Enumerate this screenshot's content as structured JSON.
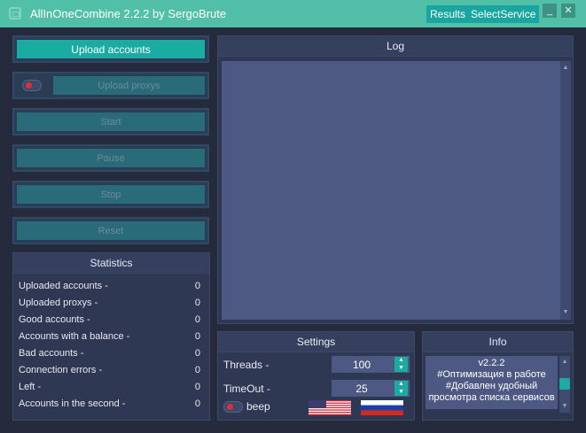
{
  "titlebar": {
    "title": "AllInOneCombine 2.2.2 by SergoBrute",
    "tabs": [
      "Results",
      "SelectService"
    ],
    "minimize_label": "_",
    "close_label": "✕"
  },
  "left_buttons": {
    "upload_accounts": "Upload accounts",
    "upload_proxys": "Upload proxys",
    "start": "Start",
    "pause": "Pause",
    "stop": "Stop",
    "reset": "Reset"
  },
  "statistics": {
    "title": "Statistics",
    "rows": [
      {
        "label": "Uploaded accounts -",
        "value": "0"
      },
      {
        "label": "Uploaded proxys -",
        "value": "0"
      },
      {
        "label": "Good accounts -",
        "value": "0"
      },
      {
        "label": "Accounts with a balance -",
        "value": "0"
      },
      {
        "label": "Bad accounts -",
        "value": "0"
      },
      {
        "label": "Connection errors -",
        "value": "0"
      },
      {
        "label": "Left -",
        "value": "0"
      },
      {
        "label": "Accounts in the second -",
        "value": "0"
      }
    ]
  },
  "log": {
    "title": "Log",
    "content": ""
  },
  "settings": {
    "title": "Settings",
    "threads_label": "Threads -",
    "threads_value": "100",
    "timeout_label": "TimeOut -",
    "timeout_value": "25",
    "beep_label": "beep"
  },
  "info": {
    "title": "Info",
    "lines": [
      "v2.2.2",
      "#Оптимизация в работе",
      "#Добавлен удобный",
      "просмотра списка сервисов"
    ]
  },
  "colors": {
    "titlebar": "#52bfa9",
    "accent": "#1aaba2",
    "panel": "#2f3853",
    "toggle_dot": "#e12d3c"
  },
  "icons": [
    "app-icon",
    "minimize-icon",
    "close-icon",
    "spin-up-icon",
    "spin-down-icon",
    "us-flag-icon",
    "ru-flag-icon"
  ]
}
